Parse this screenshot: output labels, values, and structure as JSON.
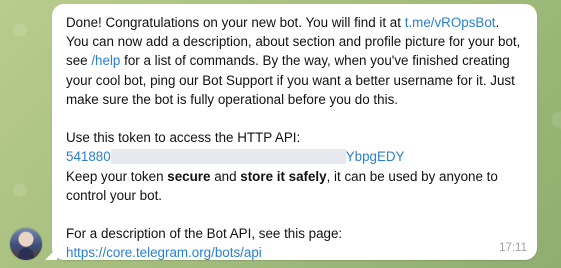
{
  "message": {
    "line1_text": "Done! Congratulations on your new bot. You will find it at",
    "bot_link": "t.me/vROpsBot",
    "line2_text": ". You can now add a description, about section and profile picture for your bot, see",
    "help_link": "/help",
    "line3_text": "for a list of commands. By the way, when you've finished creating your cool bot, ping our Bot Support if you want a better username for it. Just make sure the bot is fully operational before you do this.",
    "token_intro": "Use this token to access the HTTP API:",
    "token_start": "541880",
    "token_end": "YbpgEDY",
    "keep_prefix": "Keep your token",
    "keep_secure": "secure",
    "keep_and": "and",
    "keep_store": "store it safely",
    "keep_suffix": ", it can be used by anyone to control your bot.",
    "api_intro": "For a description of the Bot API, see this page:",
    "api_link": "https://core.telegram.org/bots/api",
    "time": "17:11"
  },
  "colors": {
    "link": "#2a7fd4",
    "bubble": "#ffffff",
    "timestamp": "#9aa0a6"
  }
}
